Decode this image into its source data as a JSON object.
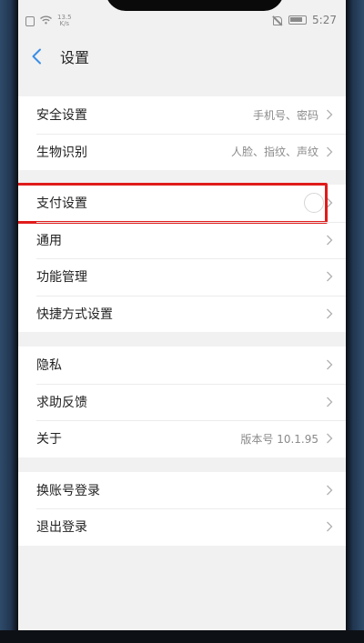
{
  "status_bar": {
    "speed": "13.5\nK/s",
    "time": "5:27"
  },
  "header": {
    "title": "设置"
  },
  "groups": [
    {
      "items": [
        {
          "label": "安全设置",
          "value": "手机号、密码"
        },
        {
          "label": "生物识别",
          "value": "人脸、指纹、声纹"
        }
      ]
    },
    {
      "items": [
        {
          "label": "支付设置",
          "value": ""
        },
        {
          "label": "通用",
          "value": ""
        },
        {
          "label": "功能管理",
          "value": ""
        },
        {
          "label": "快捷方式设置",
          "value": ""
        }
      ]
    },
    {
      "items": [
        {
          "label": "隐私",
          "value": ""
        },
        {
          "label": "求助反馈",
          "value": ""
        },
        {
          "label": "关于",
          "value": "版本号 10.1.95"
        }
      ]
    },
    {
      "items": [
        {
          "label": "换账号登录",
          "value": ""
        },
        {
          "label": "退出登录",
          "value": ""
        }
      ]
    }
  ],
  "colors": {
    "accent": "#3a8ee6",
    "highlight": "#e01b1b",
    "background": "#f1f1f1"
  },
  "icons": {
    "back": "chevron-left-icon",
    "row_arrow": "chevron-right-icon"
  }
}
